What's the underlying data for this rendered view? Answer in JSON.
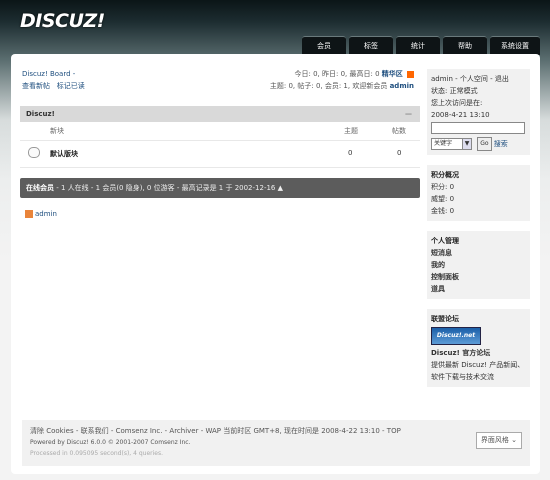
{
  "logo": "DISCUZ!",
  "nav": [
    {
      "label": "会员",
      "w": 44
    },
    {
      "label": "标签",
      "w": 44
    },
    {
      "label": "统计",
      "w": 44
    },
    {
      "label": "帮助",
      "w": 44
    },
    {
      "label": "系统设置",
      "w": 50
    }
  ],
  "toolbar": {
    "board_title": "Discuz! Board -",
    "new_posts": "查看新帖",
    "mark_read": "标记已读",
    "stats_line1": "今日: 0, 昨日: 0, 最高日: 0",
    "archive_link": "精华区",
    "stats_line2": "主题: 0, 帖子: 0, 会员: 1, 欢迎新会员",
    "new_member": "admin"
  },
  "forum": {
    "header": "Discuz!",
    "collapse": "—",
    "col_name": "新块",
    "col_topics": "主题",
    "col_posts": "帖数",
    "row_name": "默认版块",
    "row_topics": "0",
    "row_posts": "0"
  },
  "online": {
    "label": "在线会员",
    "detail": "- 1 人在线 - 1 会员(0 隐身), 0 位游客 - 最高记录是 1 于 2002-12-16",
    "user": "admin"
  },
  "sidebar": {
    "user_line": "admin - 个人空间 - 退出",
    "status": "状态: 正常模式",
    "last_visit_label": "您上次访问是在:",
    "last_visit": "2008-4-21 13:10",
    "keyword": "关键字",
    "go": "Go",
    "search": "搜索",
    "credits_title": "积分概况",
    "credits": "积分: 0",
    "prestige": "威望: 0",
    "money": "金钱: 0",
    "personal_title": "个人管理",
    "pm": "短消息",
    "mine": "我的",
    "control_panel": "控制面板",
    "props": "道具",
    "union_title": "联盟论坛",
    "banner": "Discuz!.net",
    "official": "Discuz! 官方论坛",
    "official_desc": "提供最新 Discuz! 产品新闻、软件下载与技术交流"
  },
  "footer": {
    "links": "清除 Cookies - 联系我们 - Comsenz Inc. - Archiver - WAP  当前时区 GMT+8, 现在时间是 2008-4-22 13:10 - TOP",
    "powered": "Powered by Discuz! 6.0.0 © 2001-2007 Comsenz Inc.",
    "processed": "Processed in 0.095095 second(s), 4 queries.",
    "style_btn": "界面风格 ⌄"
  }
}
